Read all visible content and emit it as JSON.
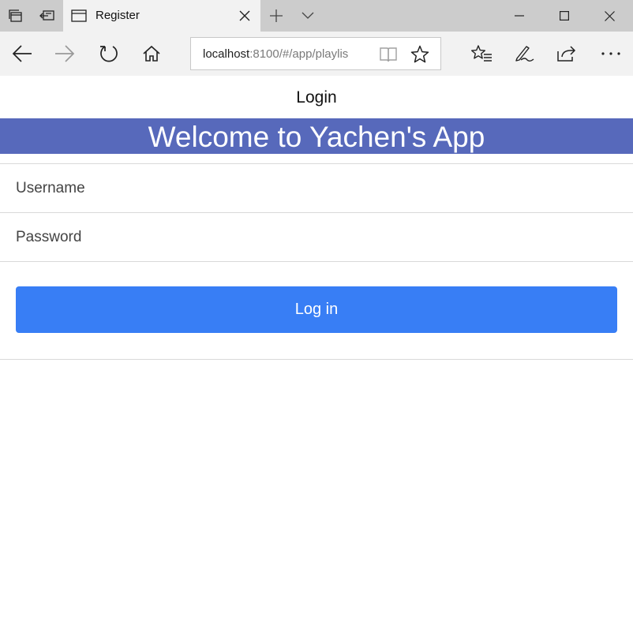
{
  "browser": {
    "tab": {
      "title": "Register"
    },
    "address": {
      "host": "localhost",
      "rest": ":8100/#/app/playlis"
    },
    "icons": {
      "tab_manager": "tab-manager-icon",
      "set_aside": "set-aside-tabs-icon",
      "tab_page": "tab-page-icon",
      "tab_close": "close-icon",
      "new_tab": "plus-icon",
      "tab_preview": "chevron-down-icon",
      "minimize": "minimize-icon",
      "maximize": "maximize-icon",
      "close_window": "close-icon",
      "back": "back-arrow-icon",
      "forward": "forward-arrow-icon",
      "refresh": "refresh-icon",
      "home": "home-icon",
      "reading_view": "book-icon",
      "favorite": "star-icon",
      "favorites_hub": "favorites-list-icon",
      "notes": "pen-icon",
      "share": "share-icon",
      "more": "more-icon"
    }
  },
  "app": {
    "header_title": "Login",
    "welcome": "Welcome to Yachen's App",
    "form": {
      "username_placeholder": "Username",
      "password_placeholder": "Password",
      "login_label": "Log in"
    },
    "colors": {
      "banner": "#5769bb",
      "button": "#387ef5"
    }
  }
}
